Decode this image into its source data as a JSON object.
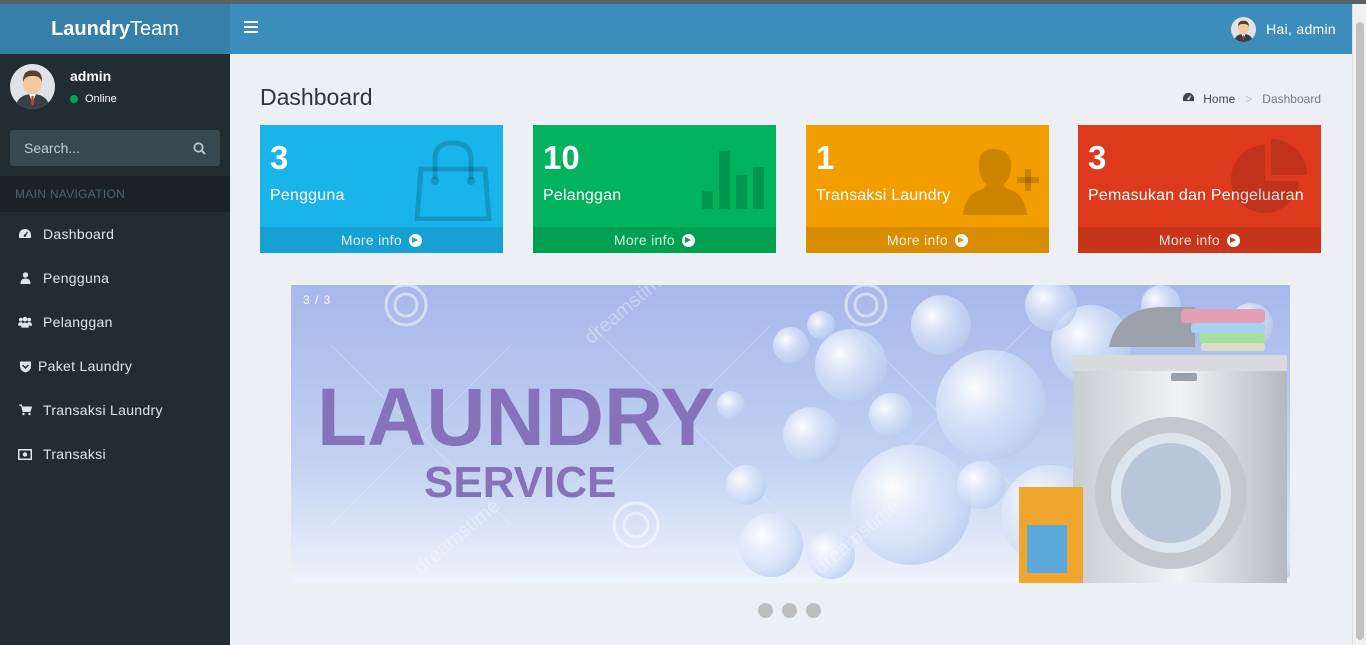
{
  "brand": {
    "bold": "Laundry",
    "light": "Team"
  },
  "navbar": {
    "greeting": "Hai, admin"
  },
  "sidebar": {
    "username": "admin",
    "status": "Online",
    "search_placeholder": "Search...",
    "header": "MAIN NAVIGATION",
    "items": [
      {
        "label": "Dashboard",
        "icon": "dashboard-icon"
      },
      {
        "label": "Pengguna",
        "icon": "user-icon"
      },
      {
        "label": "Pelanggan",
        "icon": "users-icon"
      },
      {
        "label": "Paket Laundry",
        "icon": "shield-icon"
      },
      {
        "label": "Transaksi Laundry",
        "icon": "cart-icon"
      },
      {
        "label": "Transaksi",
        "icon": "money-icon"
      }
    ]
  },
  "page": {
    "title": "Dashboard"
  },
  "breadcrumb": {
    "home": "Home",
    "current": "Dashboard"
  },
  "stats": [
    {
      "number": "3",
      "label": "Pengguna",
      "footer": "More info",
      "color": "#19b4ea",
      "icon": "shopping-bag-icon"
    },
    {
      "number": "10",
      "label": "Pelanggan",
      "footer": "More info",
      "color": "#00b35c",
      "icon": "bar-chart-icon"
    },
    {
      "number": "1",
      "label": "Transaksi Laundry",
      "footer": "More info",
      "color": "#f29d00",
      "icon": "user-plus-icon"
    },
    {
      "number": "3",
      "label": "Pemasukan dan Pengeluaran",
      "footer": "More info",
      "color": "#dd3a1d",
      "icon": "pie-chart-icon"
    }
  ],
  "carousel": {
    "counter": "3 / 3",
    "slide_title": "LAUNDRY",
    "slide_subtitle": "SERVICE",
    "watermark": "dreamstime",
    "indicator_count": 3
  },
  "colors": {
    "navbar": "#3c8dbc",
    "logo": "#367fa9",
    "sidebar": "#222d32",
    "content_bg": "#ecf0f5",
    "online": "#00a65a"
  }
}
